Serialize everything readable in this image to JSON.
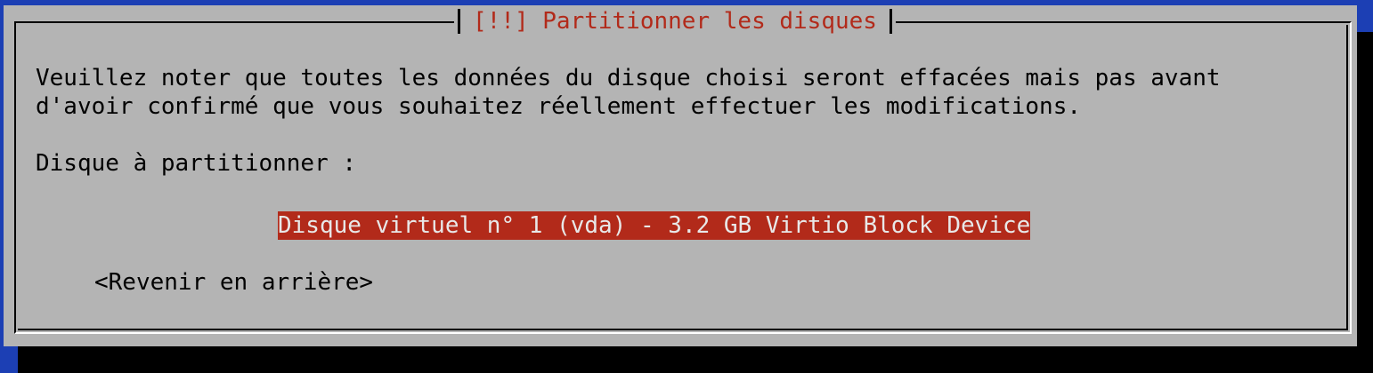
{
  "dialog": {
    "title": "[!!] Partitionner les disques",
    "message_line1": "Veuillez noter que toutes les données du disque choisi seront effacées mais pas avant",
    "message_line2": "d'avoir confirmé que vous souhaitez réellement effectuer les modifications.",
    "prompt_label": "Disque à partitionner :",
    "disk_options": [
      {
        "label": "Disque virtuel n° 1 (vda) - 3.2 GB Virtio Block Device",
        "selected": true
      }
    ],
    "back_button": "<Revenir en arrière>"
  },
  "colors": {
    "background": "#1c3fb4",
    "dialog": "#b4b4b4",
    "title_text": "#b22a1a",
    "selection_bg": "#b22a1a",
    "selection_text": "#e8e8e8",
    "shadow": "#000000"
  }
}
